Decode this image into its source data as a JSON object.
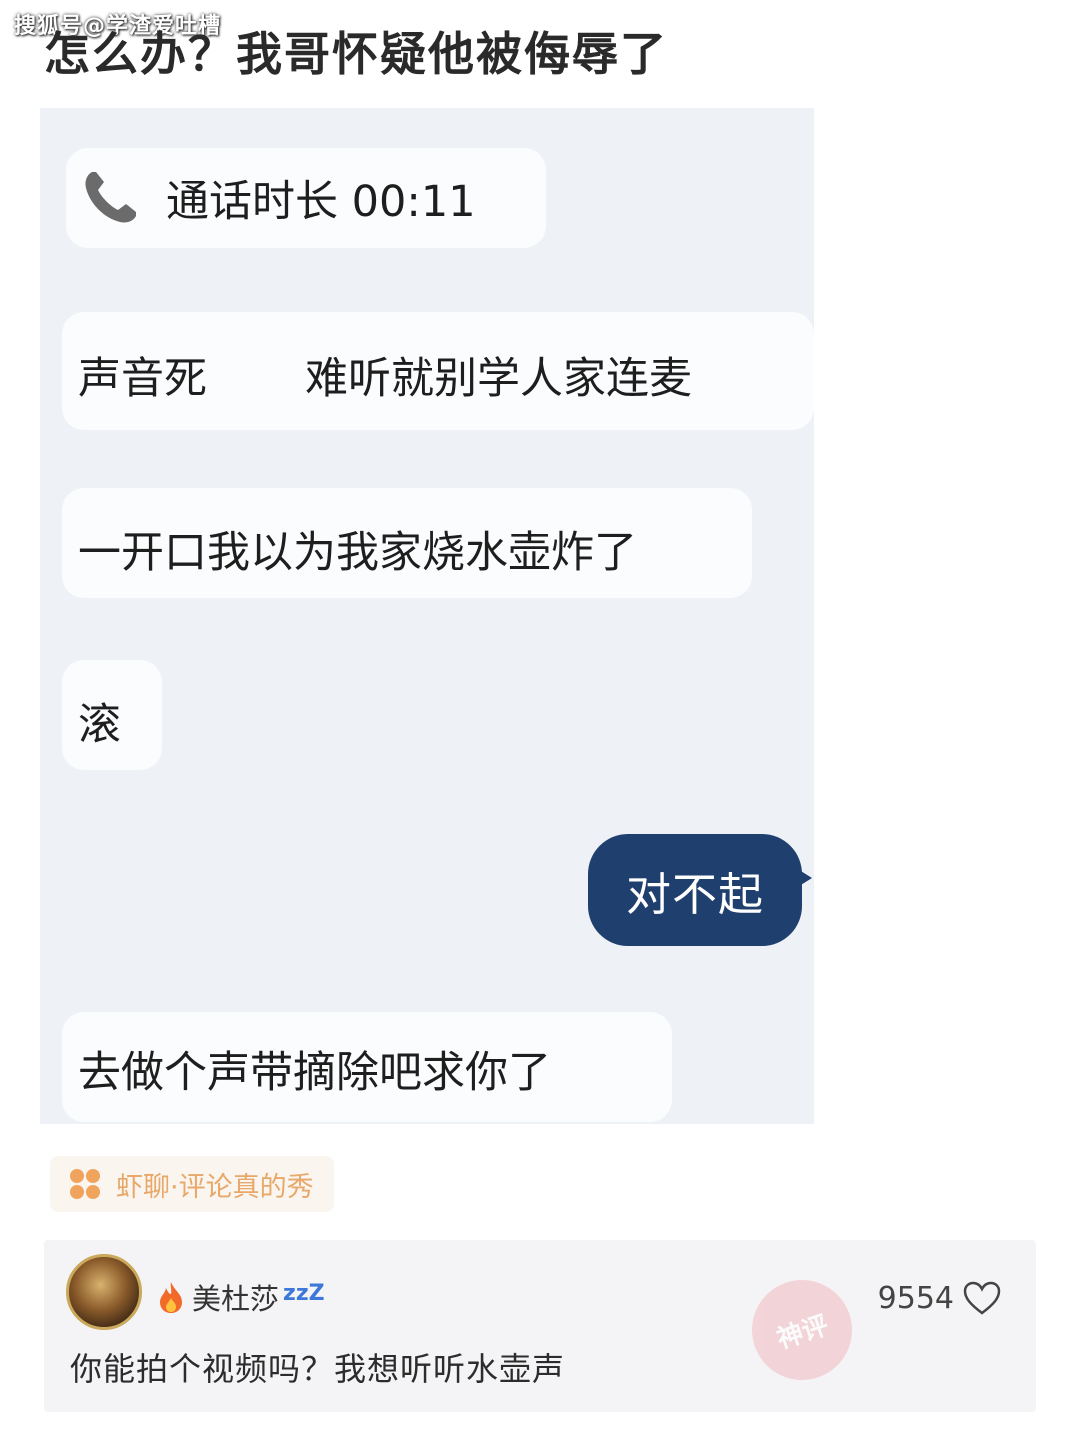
{
  "watermark": "搜狐号@学渣爱吐槽",
  "post_title": "怎么办？我哥怀疑他被侮辱了",
  "chat": {
    "call_duration": "通话时长 00:11",
    "messages": {
      "msg1_start": "声音死",
      "msg1_end": "难听就别学人家连麦",
      "msg2": "一开口我以为我家烧水壶炸了",
      "msg3": "滚",
      "reply": "对不起",
      "msg5": "去做个声带摘除吧求你了"
    }
  },
  "source_tag": "虾聊·评论真的秀",
  "comment": {
    "username": "美杜莎",
    "username_suffix": "zzZ",
    "likes": "9554",
    "text": "你能拍个视频吗？我想听听水壶声",
    "stamp_text": "神评"
  },
  "colors": {
    "chat_bg": "#eef1f6",
    "bubble_left": "#fbfcfd",
    "bubble_right": "#1f3f6e",
    "source_tag_text": "#e7a86a",
    "comment_bg": "#f4f4f6"
  }
}
